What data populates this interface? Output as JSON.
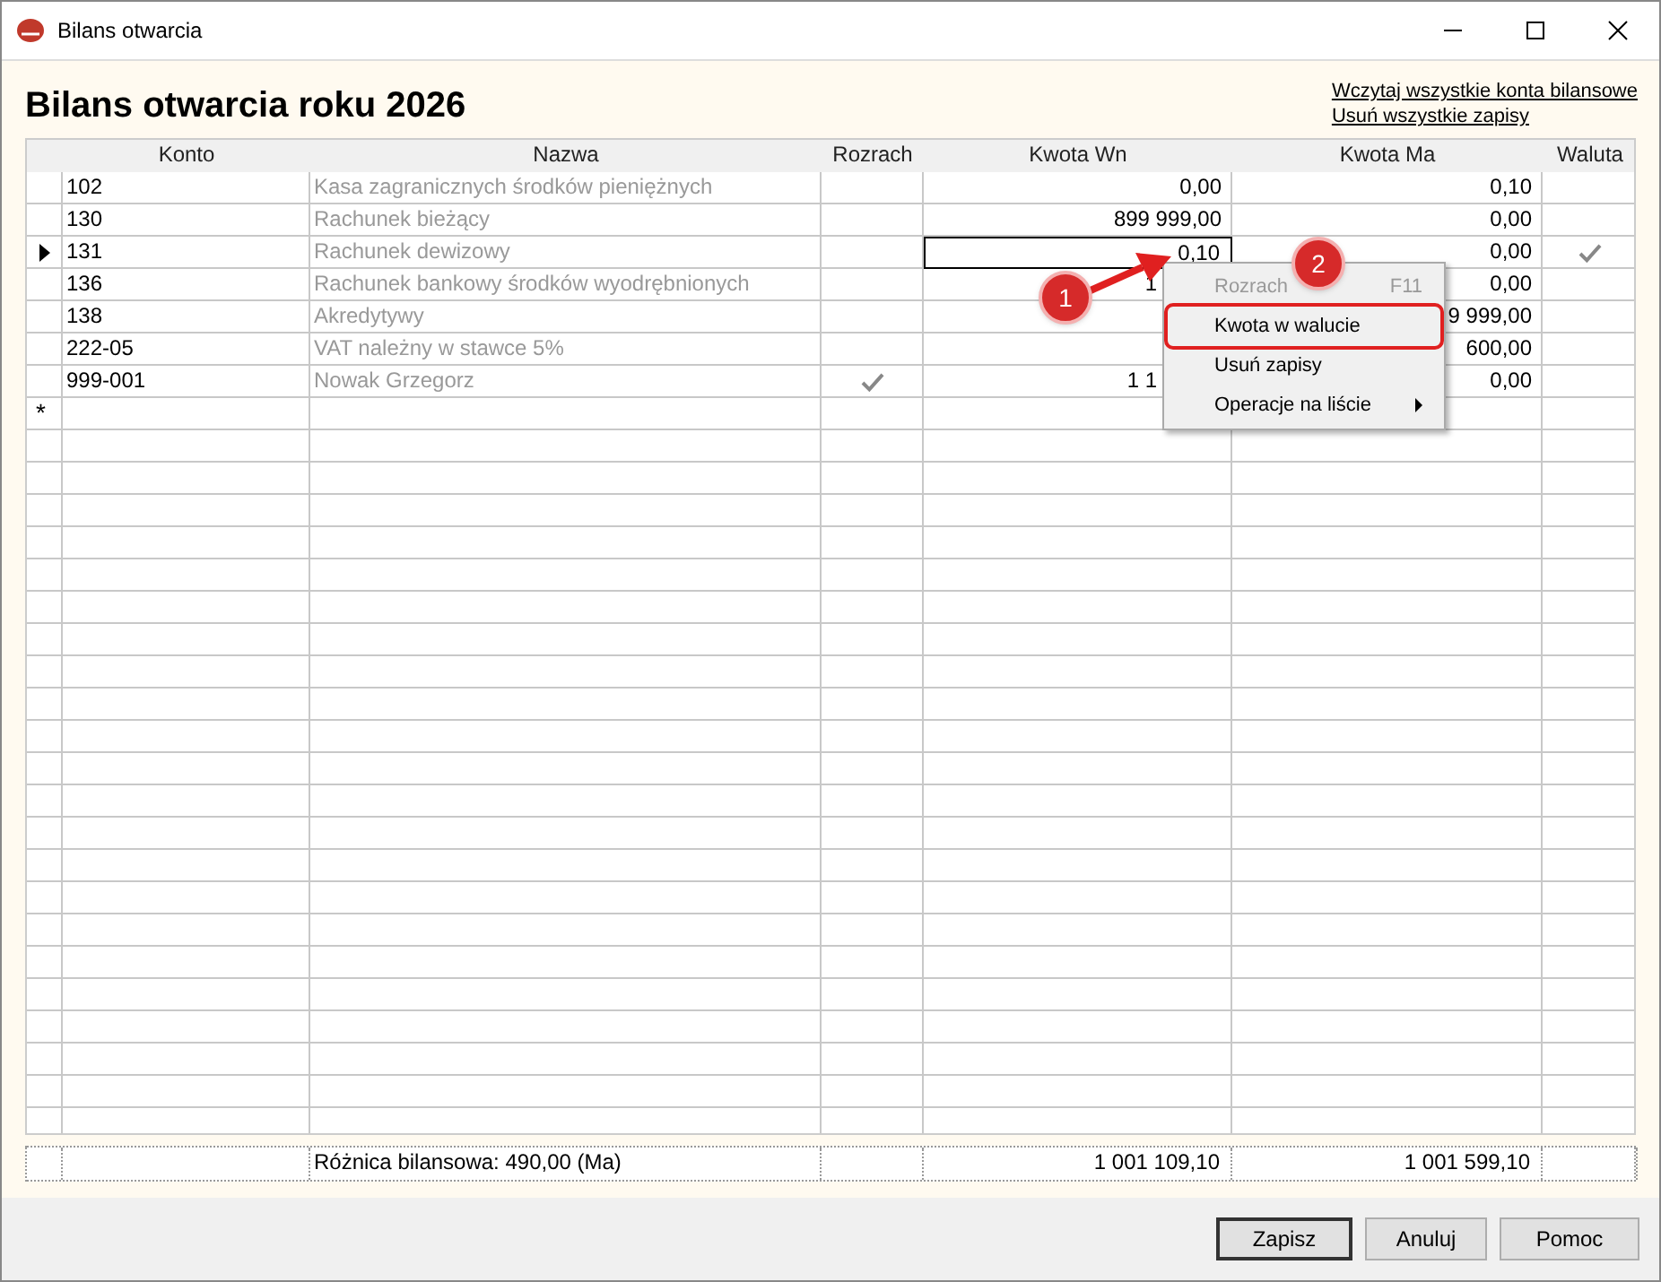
{
  "window": {
    "title": "Bilans otwarcia"
  },
  "heading": "Bilans otwarcia roku 2026",
  "links": [
    "Wczytaj wszystkie konta bilansowe",
    "Usuń wszystkie zapisy"
  ],
  "table": {
    "columns": [
      "Konto",
      "Nazwa",
      "Rozrach",
      "Kwota Wn",
      "Kwota Ma",
      "Waluta"
    ],
    "rows": [
      {
        "konto": "102",
        "nazwa": "Kasa zagranicznych środków pieniężnych",
        "rozrach": false,
        "wn": "0,00",
        "ma": "0,10",
        "waluta": false,
        "selected": false,
        "wn_focused": false
      },
      {
        "konto": "130",
        "nazwa": "Rachunek bieżący",
        "rozrach": false,
        "wn": "899 999,00",
        "ma": "0,00",
        "waluta": false,
        "selected": false,
        "wn_focused": false
      },
      {
        "konto": "131",
        "nazwa": "Rachunek dewizowy",
        "rozrach": false,
        "wn": "0,10",
        "ma": "0,00",
        "waluta": true,
        "selected": true,
        "wn_focused": true
      },
      {
        "konto": "136",
        "nazwa": "Rachunek bankowy środków wyodrębnionych",
        "rozrach": false,
        "wn": "1",
        "ma": "0,00",
        "waluta": false,
        "selected": false,
        "wn_focused": false,
        "wn_covered": true
      },
      {
        "konto": "138",
        "nazwa": "Akredytywy",
        "rozrach": false,
        "ma": "9 999,00",
        "waluta": false,
        "selected": false,
        "wn_focused": false
      },
      {
        "konto": "222-05",
        "nazwa": "VAT należny w stawce 5%",
        "rozrach": false,
        "ma": "600,00",
        "waluta": false,
        "selected": false,
        "wn_focused": false
      },
      {
        "konto": "999-001",
        "nazwa": "Nowak Grzegorz",
        "rozrach": true,
        "wn": "1 1",
        "ma": "0,00",
        "waluta": false,
        "selected": false,
        "wn_focused": false,
        "wn_covered": true
      }
    ],
    "new_row_marker": "*",
    "footer": {
      "nazwa": "Różnica bilansowa: 490,00 (Ma)",
      "wn": "1 001 109,10",
      "ma": "1 001 599,10"
    }
  },
  "context_menu": [
    {
      "label": "Rozrach",
      "shortcut": "F11",
      "disabled": true,
      "submenu": false
    },
    {
      "label": "Kwota w walucie",
      "disabled": false,
      "submenu": false
    },
    {
      "label": "Usuń zapisy",
      "disabled": false,
      "submenu": false
    },
    {
      "label": "Operacje na liście",
      "disabled": false,
      "submenu": true
    }
  ],
  "annotations": [
    {
      "number": "1"
    },
    {
      "number": "2"
    }
  ],
  "buttons": [
    "Zapisz",
    "Anuluj",
    "Pomoc"
  ]
}
